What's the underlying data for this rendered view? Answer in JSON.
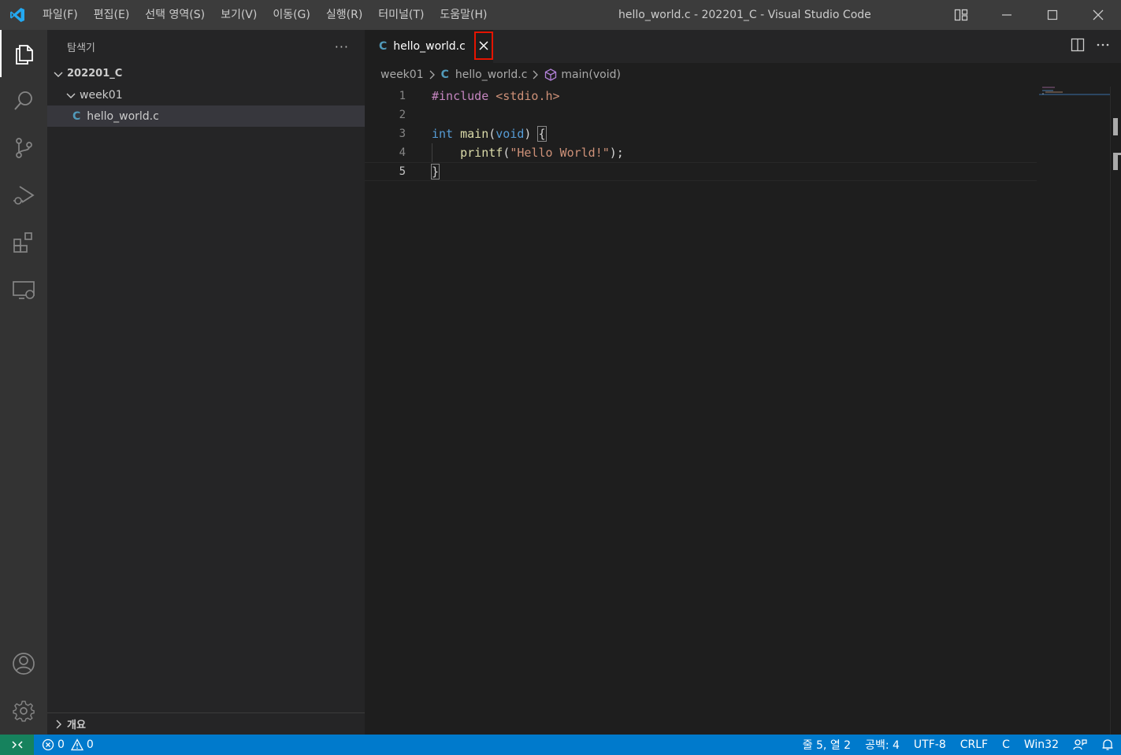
{
  "titlebar": {
    "menu": [
      "파일(F)",
      "편집(E)",
      "선택 영역(S)",
      "보기(V)",
      "이동(G)",
      "실행(R)",
      "터미널(T)",
      "도움말(H)"
    ],
    "window_title": "hello_world.c - 202201_C - Visual Studio Code"
  },
  "sidebar": {
    "title": "탐색기",
    "more": "···",
    "root": "202201_C",
    "folder": "week01",
    "file": "hello_world.c",
    "file_glyph": "C",
    "outline": "개요"
  },
  "tab": {
    "label": "hello_world.c",
    "glyph": "C"
  },
  "breadcrumb": {
    "folder": "week01",
    "file": "hello_world.c",
    "file_glyph": "C",
    "symbol": "main(void)"
  },
  "editor": {
    "line_numbers": [
      "1",
      "2",
      "3",
      "4",
      "5"
    ],
    "current_line": 5,
    "line1": {
      "directive": "#include",
      "header": " <stdio.h>"
    },
    "line3": {
      "type": "int",
      "space": " ",
      "fn": "main",
      "open": "(",
      "param": "void",
      "close": ") ",
      "brace": "{"
    },
    "line4": {
      "indent": "    ",
      "fn": "printf",
      "open": "(",
      "str": "\"Hello World!\"",
      "close": ");"
    },
    "line5": {
      "brace": "}"
    }
  },
  "statusbar": {
    "errors": "0",
    "warnings": "0",
    "position": "줄 5, 열 2",
    "spaces": "공백: 4",
    "encoding": "UTF-8",
    "eol": "CRLF",
    "language": "C",
    "platform": "Win32"
  },
  "colors": {
    "activity_bar": "#333333",
    "sidebar": "#252526",
    "editor": "#1e1e1e",
    "statusbar": "#007acc",
    "remote": "#16825d",
    "highlight_box": "#e51400"
  }
}
